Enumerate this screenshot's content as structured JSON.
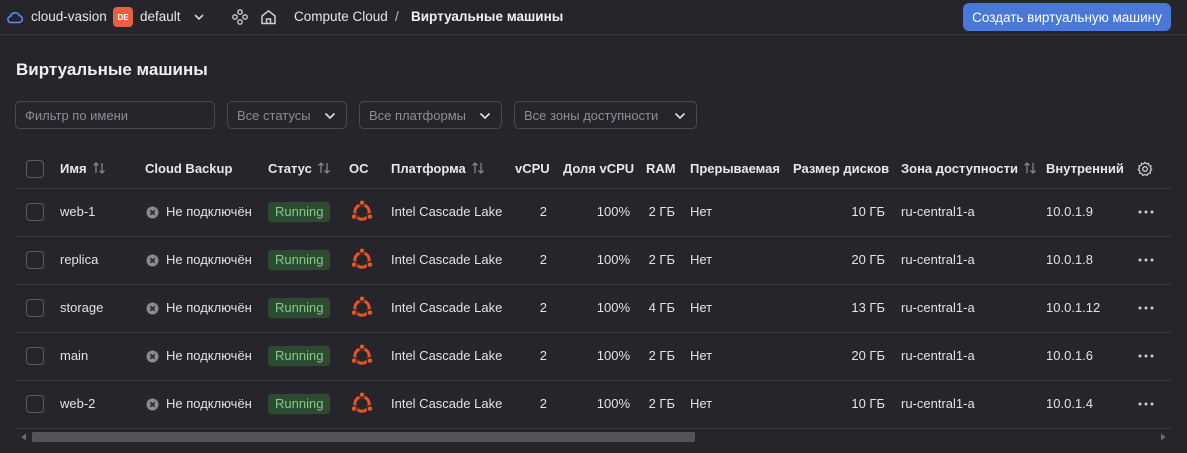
{
  "header": {
    "cloud_name": "cloud-vasion",
    "folder_badge": "DE",
    "folder_name": "default",
    "breadcrumb_service": "Compute Cloud",
    "breadcrumb_sep": "/",
    "breadcrumb_page": "Виртуальные машины",
    "create_button": "Создать виртуальную машину",
    "accent_color": "#4a78d9"
  },
  "page": {
    "title": "Виртуальные машины"
  },
  "filters": {
    "name_placeholder": "Фильтр по имени",
    "status": "Все статусы",
    "platform": "Все платформы",
    "zone": "Все зоны доступности"
  },
  "table": {
    "columns": {
      "name": "Имя",
      "backup": "Cloud Backup",
      "status": "Статус",
      "os": "ОС",
      "platform": "Платформа",
      "vcpu": "vCPU",
      "vcpu_share": "Доля vCPU",
      "ram": "RAM",
      "preemptible": "Прерываемая",
      "disk_size": "Размер дисков",
      "zone": "Зона доступности",
      "internal": "Внутренний"
    },
    "rows": [
      {
        "name": "web-1",
        "backup": "Не подключён",
        "status": "Running",
        "os_icon": "ubuntu-icon",
        "platform": "Intel Cascade Lake",
        "vcpu": "2",
        "vcpu_share": "100%",
        "ram": "2 ГБ",
        "preemptible": "Нет",
        "disk_size": "10 ГБ",
        "zone": "ru-central1-a",
        "internal": "10.0.1.9"
      },
      {
        "name": "replica",
        "backup": "Не подключён",
        "status": "Running",
        "os_icon": "ubuntu-icon",
        "platform": "Intel Cascade Lake",
        "vcpu": "2",
        "vcpu_share": "100%",
        "ram": "2 ГБ",
        "preemptible": "Нет",
        "disk_size": "20 ГБ",
        "zone": "ru-central1-a",
        "internal": "10.0.1.8"
      },
      {
        "name": "storage",
        "backup": "Не подключён",
        "status": "Running",
        "os_icon": "ubuntu-icon",
        "platform": "Intel Cascade Lake",
        "vcpu": "2",
        "vcpu_share": "100%",
        "ram": "4 ГБ",
        "preemptible": "Нет",
        "disk_size": "13 ГБ",
        "zone": "ru-central1-a",
        "internal": "10.0.1.12"
      },
      {
        "name": "main",
        "backup": "Не подключён",
        "status": "Running",
        "os_icon": "ubuntu-icon",
        "platform": "Intel Cascade Lake",
        "vcpu": "2",
        "vcpu_share": "100%",
        "ram": "2 ГБ",
        "preemptible": "Нет",
        "disk_size": "20 ГБ",
        "zone": "ru-central1-a",
        "internal": "10.0.1.6"
      },
      {
        "name": "web-2",
        "backup": "Не подключён",
        "status": "Running",
        "os_icon": "ubuntu-icon",
        "platform": "Intel Cascade Lake",
        "vcpu": "2",
        "vcpu_share": "100%",
        "ram": "2 ГБ",
        "preemptible": "Нет",
        "disk_size": "10 ГБ",
        "zone": "ru-central1-a",
        "internal": "10.0.1.4"
      }
    ]
  }
}
